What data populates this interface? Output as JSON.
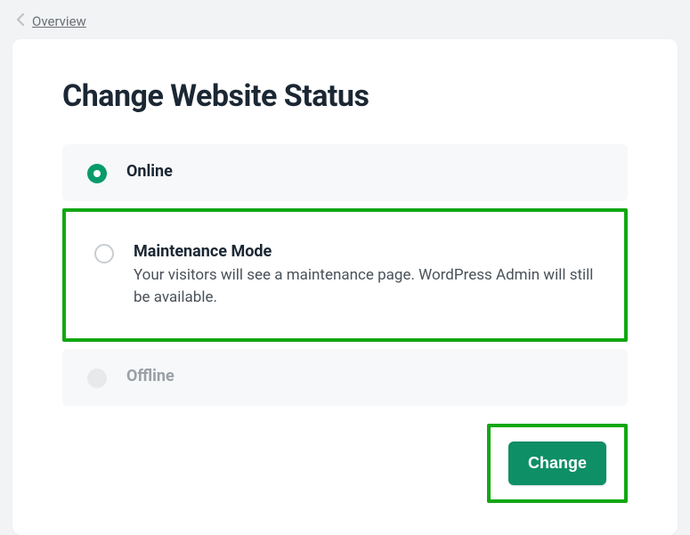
{
  "breadcrumb": {
    "label": "Overview"
  },
  "page": {
    "title": "Change Website Status"
  },
  "options": {
    "online": {
      "label": "Online"
    },
    "maintenance": {
      "label": "Maintenance Mode",
      "description": "Your visitors will see a maintenance page. WordPress Admin will still be available."
    },
    "offline": {
      "label": "Offline"
    }
  },
  "actions": {
    "change_label": "Change"
  }
}
